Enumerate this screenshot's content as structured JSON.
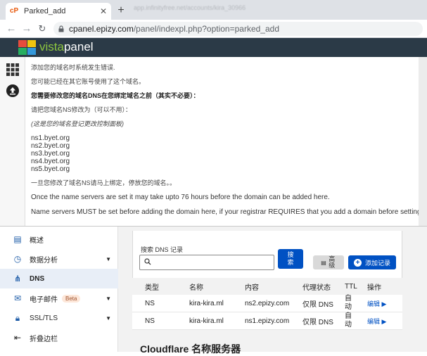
{
  "browser": {
    "tab_title": "Parked_add",
    "tab_close": "✕",
    "newtab": "+",
    "ghost_tab": "app.infinityfree.net/accounts/kira_30966",
    "url_host": "cpanel.epizy.com",
    "url_path": "/panel/indexpl.php?option=parked_add"
  },
  "vistapanel": {
    "brand_part1": "vista",
    "brand_part2": "panel",
    "logo_colors": [
      "#e74c3c",
      "#f1c40f",
      "#27ae60",
      "#3498db"
    ]
  },
  "error": {
    "line1": "添加您的域名时系统发生错误.",
    "line2": "您可能已经在其它账号使用了这个域名。",
    "line3": "您需要修改您的域名DNS在您绑定域名之前（其实不必要）：",
    "line4": "请把您域名NS修改为（可以不用）：",
    "line5": "(这是您的域名登记更改控制面板)",
    "nameservers": [
      "ns1.byet.org",
      "ns2.byet.org",
      "ns3.byet.org",
      "ns4.byet.org",
      "ns5.byet.org"
    ],
    "line6": "一旦您修改了域名NS请马上绑定，停放您的域名。。",
    "line7": "Once the name servers are set it may take upto 76 hours before the domain can be added here.",
    "line8": "Name servers MUST be set before adding the domain here, if your registrar REQUIRES that you add a domain before setting the name servers"
  },
  "sidebar": {
    "items": [
      {
        "label": "概述",
        "icon": "document-icon"
      },
      {
        "label": "数据分析",
        "icon": "clock-icon"
      },
      {
        "label": "DNS",
        "icon": "network-icon"
      },
      {
        "label": "电子邮件",
        "icon": "mail-icon",
        "badge": "Beta"
      },
      {
        "label": "SSL/TLS",
        "icon": "lock-icon"
      },
      {
        "label": "折叠边栏",
        "icon": "collapse-icon"
      }
    ]
  },
  "dns": {
    "search_label": "搜索 DNS 记录",
    "search_placeholder": "",
    "search_button": "搜索",
    "advanced_button": "高级",
    "add_record_button": "添加记录",
    "columns": [
      "类型",
      "名称",
      "内容",
      "代理状态",
      "TTL",
      "操作"
    ],
    "rows": [
      {
        "type": "NS",
        "name": "kira-kira.ml",
        "content": "ns2.epizy.com",
        "proxy": "仅限 DNS",
        "ttl": "自动",
        "action": "编辑 ▶"
      },
      {
        "type": "NS",
        "name": "kira-kira.ml",
        "content": "ns1.epizy.com",
        "proxy": "仅限 DNS",
        "ttl": "自动",
        "action": "编辑 ▶"
      }
    ],
    "nameserver_heading": "Cloudflare 名称服务器"
  }
}
